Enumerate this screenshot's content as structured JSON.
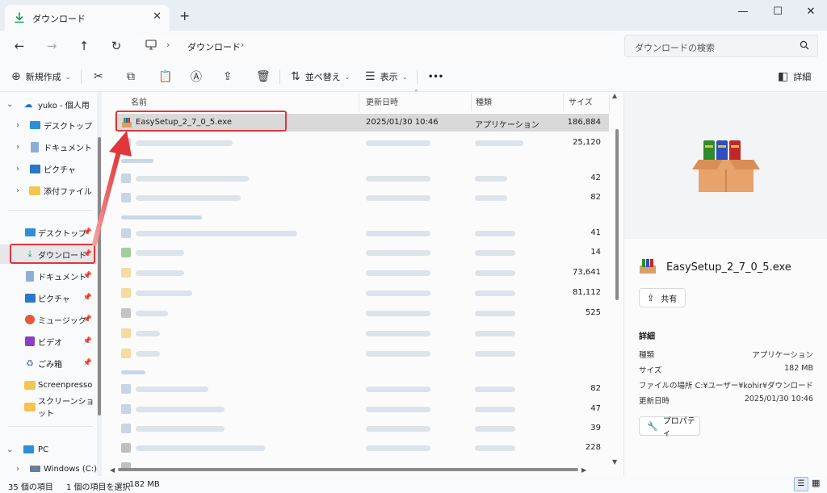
{
  "window": {
    "tab_title": "ダウンロード",
    "tab_close": "✕",
    "new_tab": "+",
    "minimize": "—",
    "maximize": "☐",
    "close": "✕"
  },
  "address": {
    "location": "ダウンロード",
    "search_placeholder": "ダウンロードの検索"
  },
  "toolbar": {
    "new_label": "新規作成",
    "sort_label": "並べ替え",
    "view_label": "表示",
    "more_label": "•••",
    "details_label": "詳細"
  },
  "sidebar": {
    "top_items": [
      {
        "label": "yuko - 個人用",
        "icon": "cloud-icon"
      },
      {
        "label": "デスクトップ",
        "icon": "desktop-icon"
      },
      {
        "label": "ドキュメント",
        "icon": "document-icon"
      },
      {
        "label": "ピクチャ",
        "icon": "picture-icon"
      },
      {
        "label": "添付ファイル",
        "icon": "folder-icon"
      }
    ],
    "quick_items": [
      {
        "label": "デスクトップ",
        "icon": "desktop-icon"
      },
      {
        "label": "ダウンロード",
        "icon": "download-icon"
      },
      {
        "label": "ドキュメント",
        "icon": "document-icon"
      },
      {
        "label": "ピクチャ",
        "icon": "picture-icon"
      },
      {
        "label": "ミュージック",
        "icon": "music-icon"
      },
      {
        "label": "ビデオ",
        "icon": "video-icon"
      },
      {
        "label": "ごみ箱",
        "icon": "recycle-bin-icon"
      },
      {
        "label": "Screenpresso",
        "icon": "folder-icon"
      },
      {
        "label": "スクリーンショット",
        "icon": "folder-icon"
      }
    ],
    "bottom_items": [
      {
        "label": "PC",
        "icon": "pc-icon"
      },
      {
        "label": "Windows (C:)",
        "icon": "drive-icon"
      }
    ]
  },
  "columns": {
    "name": "名前",
    "modified": "更新日時",
    "type": "種類",
    "size": "サイズ"
  },
  "files": {
    "selected": {
      "name": "EasySetup_2_7_0_5.exe",
      "modified": "2025/01/30 10:46",
      "type": "アプリケーション",
      "size": "186,884"
    },
    "blurred_sizes": [
      "25,120",
      "42",
      "82",
      "41",
      "14",
      "73,641",
      "81,112",
      "525",
      "82",
      "47",
      "39",
      "228"
    ]
  },
  "details": {
    "file_name": "EasySetup_2_7_0_5.exe",
    "share_label": "共有",
    "section_title": "詳細",
    "props": [
      {
        "key": "種類",
        "value": "アプリケーション"
      },
      {
        "key": "サイズ",
        "value": "182 MB"
      },
      {
        "key": "ファイルの場所",
        "value": "C:¥ユーザー¥kohir¥ダウンロード"
      },
      {
        "key": "更新日時",
        "value": "2025/01/30 10:46"
      }
    ],
    "properties_label": "プロパティ"
  },
  "status": {
    "count": "35 個の項目",
    "selection": "1 個の項目を選択",
    "size": "182 MB"
  },
  "colors": {
    "highlight": "#e0363a",
    "selected_row": "#d9d9d9",
    "accent_green": "#1c9a62"
  }
}
